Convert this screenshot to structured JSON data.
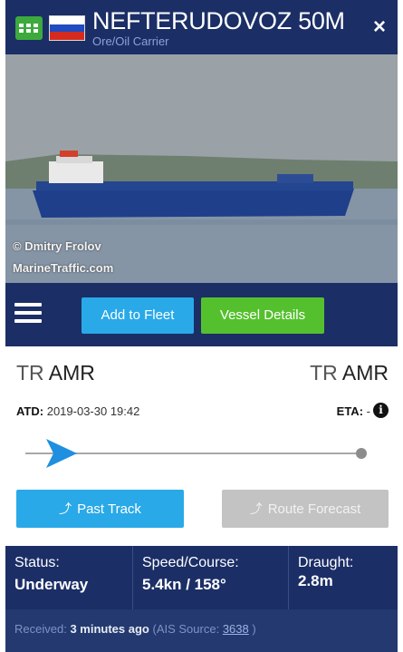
{
  "header": {
    "vessel_name": "NEFTERUDOVOZ 50M",
    "vessel_type": "Ore/Oil Carrier",
    "close_glyph": "×",
    "flag": "russia-flag"
  },
  "photo": {
    "credit_line1": "© Dmitry Frolov",
    "credit_line2": "MarineTraffic.com"
  },
  "toolbar": {
    "add_fleet_label": "Add to Fleet",
    "vessel_details_label": "Vessel Details"
  },
  "voyage": {
    "departure_country": "TR",
    "departure_port": "AMR",
    "arrival_country": "TR",
    "arrival_port": "AMR",
    "atd_label": "ATD:",
    "atd_value": "2019-03-30 19:42",
    "eta_label": "ETA:",
    "eta_value": "-",
    "info_glyph": "i",
    "progress": 0.05
  },
  "actions": {
    "past_track_label": "Past Track",
    "route_forecast_label": "Route Forecast"
  },
  "stats": {
    "status_label": "Status:",
    "status_value": "Underway",
    "speed_label": "Speed/Course:",
    "speed_value": "5.4kn / 158°",
    "draught_label": "Draught:",
    "draught_value": "2.8m"
  },
  "footer": {
    "received_label": "Received:",
    "received_value": "3 minutes ago",
    "ais_prefix": "(AIS Source:",
    "ais_source": "3638",
    "ais_suffix": ")"
  },
  "colors": {
    "navy": "#1b2e66",
    "blue_button": "#29a9e8",
    "green_button": "#55c02e",
    "grey_button": "#c3c3c3"
  }
}
